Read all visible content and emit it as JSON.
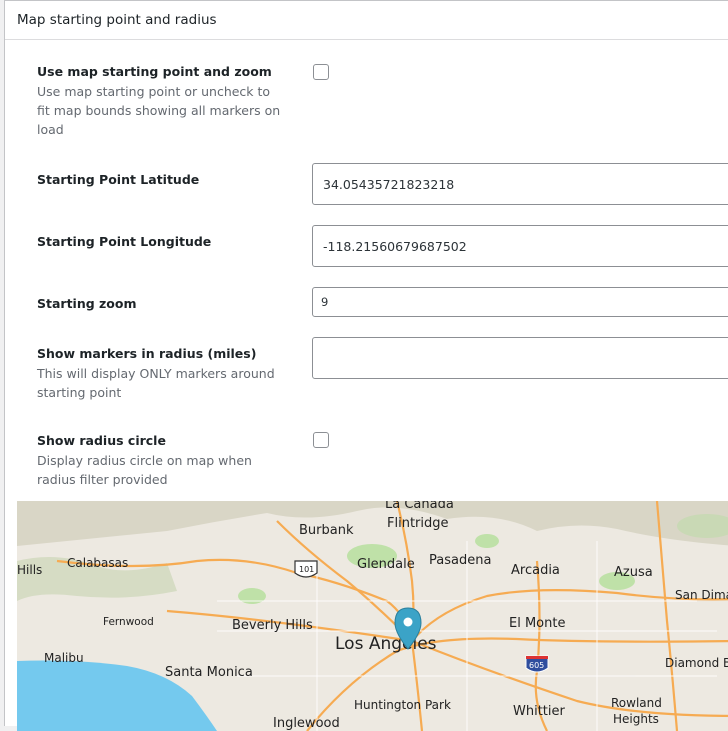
{
  "panel": {
    "title": "Map starting point and radius"
  },
  "settings": {
    "use_start": {
      "label": "Use map starting point and zoom",
      "description": "Use map starting point or uncheck to fit map bounds showing all markers on load",
      "checked": false
    },
    "latitude": {
      "label": "Starting Point Latitude",
      "value": "34.05435721823218"
    },
    "longitude": {
      "label": "Starting Point Longitude",
      "value": "-118.21560679687502"
    },
    "zoom": {
      "label": "Starting zoom",
      "value": "9"
    },
    "radius": {
      "label": "Show markers in radius (miles)",
      "description": "This will display ONLY markers around starting point",
      "value": ""
    },
    "radius_circle": {
      "label": "Show radius circle",
      "description": "Display radius circle on map when radius filter provided",
      "checked": false
    }
  },
  "map": {
    "places": [
      "La Canada",
      "Flintridge",
      "Burbank",
      "Glendale",
      "Pasadena",
      "Arcadia",
      "Azusa",
      "Calabasas",
      "San Dimas",
      "Fernwood",
      "Beverly Hills",
      "Los Angeles",
      "El Monte",
      "Malibu",
      "Santa Monica",
      "Diamond Ba",
      "Huntington Park",
      "Whittier",
      "Rowland",
      "Heights",
      "Inglewood",
      "Hills"
    ],
    "shields": [
      "101",
      "605"
    ],
    "colors": {
      "water": "#74c9ee",
      "land": "#ede9e1",
      "park": "#bfe1a8",
      "highway": "#f6ab52",
      "marker": "#3ba3c7"
    },
    "marker_icon": "map-pin-icon"
  }
}
